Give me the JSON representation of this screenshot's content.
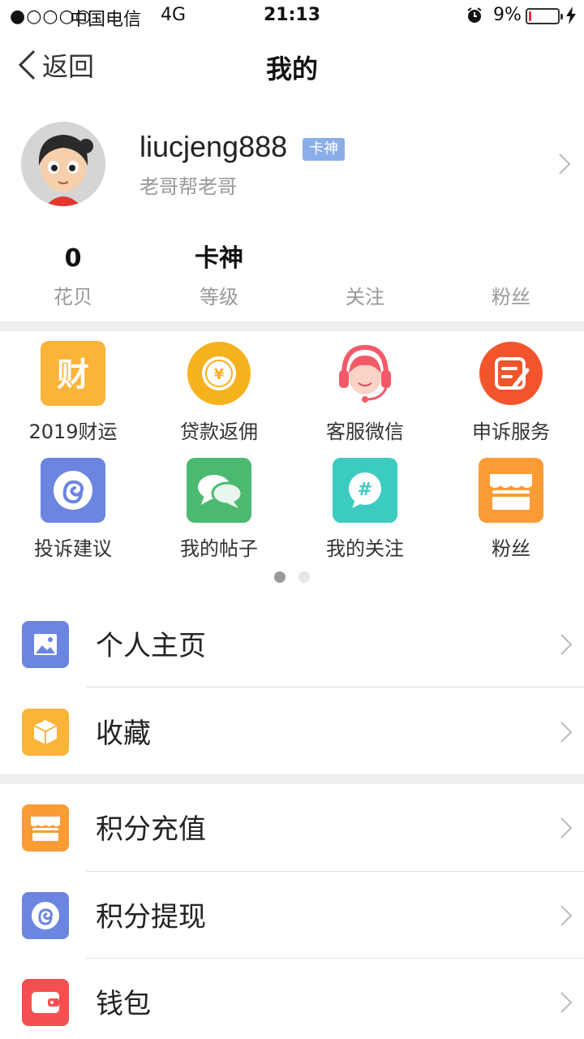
{
  "status_bar": {
    "signal": "●○○○○",
    "carrier": "中国电信",
    "network": "4G",
    "time": "21:13",
    "battery_percent": "9%",
    "battery_level": 0.09
  },
  "nav": {
    "back_label": "返回",
    "title": "我的"
  },
  "profile": {
    "username": "liucjeng888",
    "badge": "卡神",
    "signature": "老哥帮老哥"
  },
  "stats": [
    {
      "value": "0",
      "label": "花贝"
    },
    {
      "value": "卡神",
      "label": "等级"
    },
    {
      "value": "",
      "label": "关注"
    },
    {
      "value": "",
      "label": "粉丝"
    }
  ],
  "grid": [
    {
      "label": "2019财运",
      "icon": "fortune-icon",
      "color": "#fbb33a"
    },
    {
      "label": "贷款返佣",
      "icon": "coin-icon",
      "color": "#f6b21c"
    },
    {
      "label": "客服微信",
      "icon": "headset-icon",
      "color": "#f25a68"
    },
    {
      "label": "申诉服务",
      "icon": "note-edit-icon",
      "color": "#f2552c"
    },
    {
      "label": "投诉建议",
      "icon": "swirl-icon",
      "color": "#6b85e0"
    },
    {
      "label": "我的帖子",
      "icon": "chat-bubbles-icon",
      "color": "#4cb971"
    },
    {
      "label": "我的关注",
      "icon": "hashtag-icon",
      "color": "#3ccbc0"
    },
    {
      "label": "粉丝",
      "icon": "store-icon",
      "color": "#fb9b35"
    }
  ],
  "pager": {
    "pages": 2,
    "current": 1,
    "active_color": "#999999",
    "inactive_color": "#e6e6e6"
  },
  "list": [
    {
      "label": "个人主页",
      "icon": "image-icon",
      "color": "#6b85e0"
    },
    {
      "label": "收藏",
      "icon": "box-icon",
      "color": "#fbb33a"
    },
    {
      "label": "积分充值",
      "icon": "store-icon",
      "color": "#fb9b35"
    },
    {
      "label": "积分提现",
      "icon": "swirl-icon",
      "color": "#6b85e0"
    },
    {
      "label": "钱包",
      "icon": "wallet-icon",
      "color": "#f55050"
    }
  ]
}
